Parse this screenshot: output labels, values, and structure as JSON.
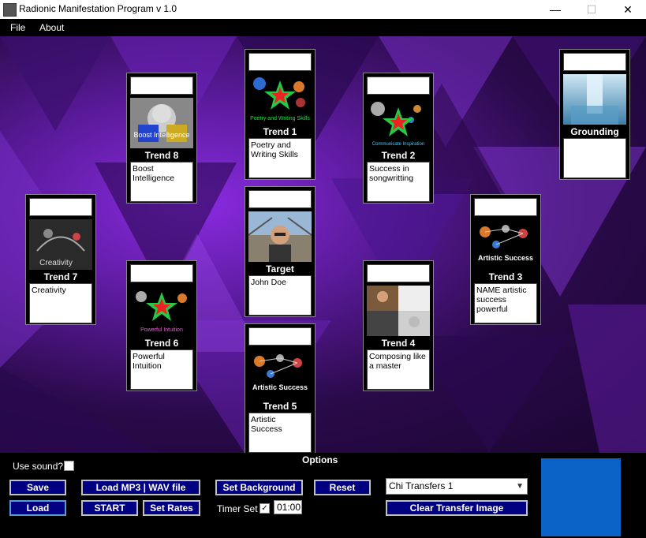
{
  "window": {
    "title": "Radionic Manifestation Program v 1.0",
    "min": "—",
    "max": "☐",
    "close": "✕"
  },
  "menu": {
    "file": "File",
    "about": "About"
  },
  "cards": {
    "trend1": {
      "label": "Trend 1",
      "text": "Poetry and Writing Skills",
      "image": "Poetry and Writing Skills"
    },
    "trend2": {
      "label": "Trend 2",
      "text": "Success in songwritting",
      "image": "Communicate Inspiration"
    },
    "trend3": {
      "label": "Trend 3",
      "text": "NAME artistic success powerful",
      "image": "Artistic Success"
    },
    "trend4": {
      "label": "Trend 4",
      "text": "Composing like a master"
    },
    "trend5": {
      "label": "Trend 5",
      "text": "Artistic Success",
      "image": "Artistic Success"
    },
    "trend6": {
      "label": "Trend 6",
      "text": "Powerful Intuition",
      "image": "Powerful Intuition"
    },
    "trend7": {
      "label": "Trend 7",
      "text": "Creativity",
      "image": "Creativity"
    },
    "trend8": {
      "label": "Trend 8",
      "text": "Boost Intelligence",
      "image": "Boost Intelligence"
    },
    "target": {
      "label": "Target",
      "text": "John Doe"
    },
    "grounding": {
      "label": "Grounding",
      "text": ""
    }
  },
  "options": {
    "title": "Options",
    "use_sound": "Use sound?",
    "save": "Save",
    "load": "Load",
    "load_mp3": "Load MP3 | WAV file",
    "start": "START",
    "set_rates": "Set Rates",
    "set_background": "Set Background",
    "reset": "Reset",
    "timer_set": "Timer Set",
    "timer_value": "01:00",
    "chi_transfers": "Chi Transfers 1",
    "clear_transfer": "Clear Transfer Image"
  },
  "colors": {
    "button_bg": "#000080",
    "accent_panel": "#0b63c8",
    "background": "#5a1a9a"
  }
}
